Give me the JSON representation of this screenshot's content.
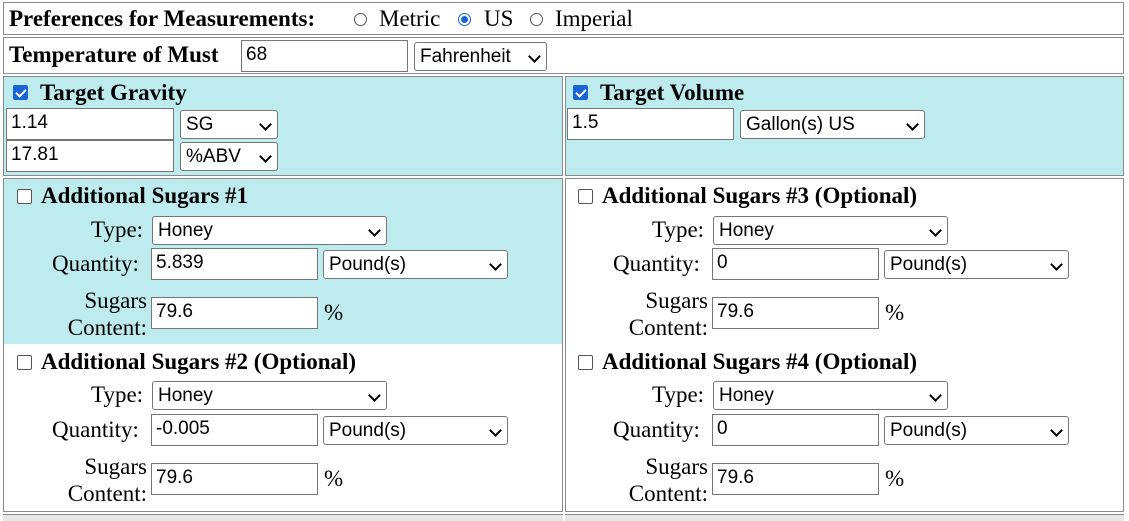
{
  "preferences": {
    "label": "Preferences for Measurements:",
    "options": [
      "Metric",
      "US",
      "Imperial"
    ],
    "selected": "US"
  },
  "temperature": {
    "label": "Temperature of Must",
    "value": "68",
    "unit": "Fahrenheit"
  },
  "target_gravity": {
    "label": "Target Gravity",
    "checked": true,
    "gravity_value": "1.14",
    "gravity_unit": "SG",
    "abv_value": "17.81",
    "abv_unit": "%ABV"
  },
  "target_volume": {
    "label": "Target Volume",
    "checked": true,
    "value": "1.5",
    "unit": "Gallon(s) US"
  },
  "field_labels": {
    "type": "Type:",
    "quantity": "Quantity:",
    "sugars_line1": "Sugars",
    "sugars_line2": "Content:",
    "percent": "%"
  },
  "sugars": [
    {
      "title": "Additional Sugars #1",
      "checked": false,
      "type": "Honey",
      "quantity": "5.839",
      "quantity_unit": "Pound(s)",
      "sugar_content": "79.6"
    },
    {
      "title": "Additional Sugars #2 (Optional)",
      "checked": false,
      "type": "Honey",
      "quantity": "-0.005",
      "quantity_unit": "Pound(s)",
      "sugar_content": "79.6"
    },
    {
      "title": "Additional Sugars #3 (Optional)",
      "checked": false,
      "type": "Honey",
      "quantity": "0",
      "quantity_unit": "Pound(s)",
      "sugar_content": "79.6"
    },
    {
      "title": "Additional Sugars #4 (Optional)",
      "checked": false,
      "type": "Honey",
      "quantity": "0",
      "quantity_unit": "Pound(s)",
      "sugar_content": "79.6"
    }
  ]
}
